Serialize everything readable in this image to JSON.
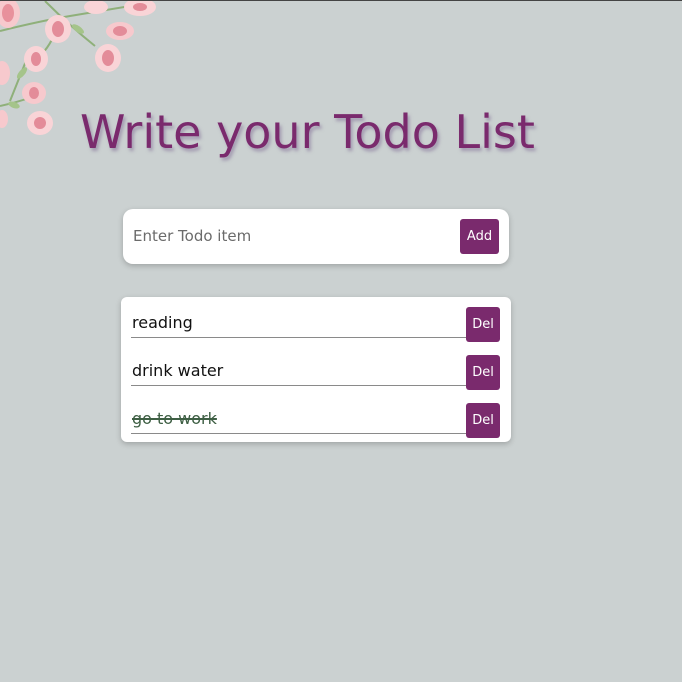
{
  "header": {
    "title": "Write your Todo List"
  },
  "form": {
    "placeholder": "Enter Todo item",
    "value": "",
    "add_label": "Add"
  },
  "todos": [
    {
      "text": "reading",
      "done": false,
      "delete_label": "Del"
    },
    {
      "text": "drink water",
      "done": false,
      "delete_label": "Del"
    },
    {
      "text": "go to work",
      "done": true,
      "delete_label": "Del"
    }
  ],
  "colors": {
    "accent": "#7a2a6d",
    "background": "#cbd1d1",
    "done_text": "#3e5f44"
  }
}
